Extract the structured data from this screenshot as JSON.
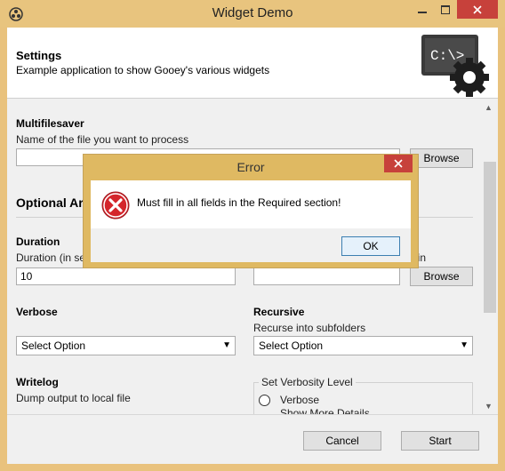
{
  "window": {
    "title": "Widget Demo",
    "accent_color": "#e9c27d",
    "close_color": "#c7413b"
  },
  "header": {
    "title": "Settings",
    "subtitle": "Example application to show Gooey's various widgets",
    "icon": "terminal-gear-icon"
  },
  "required": {
    "multifilesaver_label": "Multifilesaver",
    "multifilesaver_help": "Name of the file you want to process",
    "multifilesaver_value": "",
    "browse_label": "Browse"
  },
  "optional": {
    "section_title": "Optional Arg",
    "duration_label": "Duration",
    "duration_help": "Duration (in se",
    "duration_value": "10",
    "right_help_tail": "gin",
    "right_value": "",
    "browse_label": "Browse",
    "verbose_label": "Verbose",
    "verbose_select": "Select Option",
    "recursive_label": "Recursive",
    "recursive_help": "Recurse into subfolders",
    "recursive_select": "Select Option",
    "writelog_label": "Writelog",
    "writelog_help": "Dump output to local file",
    "verbosity_group_title": "Set Verbosity Level",
    "verbosity_option": "Verbose",
    "verbosity_option_help": "Show More Details"
  },
  "footer": {
    "cancel_label": "Cancel",
    "start_label": "Start"
  },
  "dialog": {
    "title": "Error",
    "message": "Must fill in all fields in the Required section!",
    "ok_label": "OK",
    "icon": "error-icon"
  }
}
